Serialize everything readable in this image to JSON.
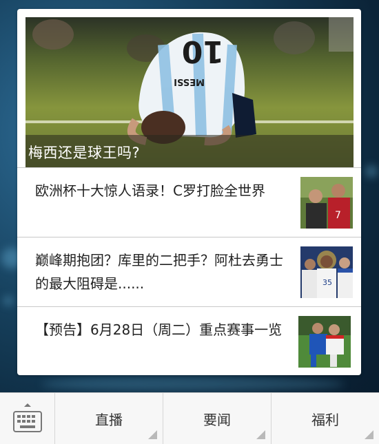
{
  "hero": {
    "caption": "梅西还是球王吗?",
    "jersey_name": "MESSI",
    "jersey_number": "10"
  },
  "news": [
    {
      "title": "欧洲杯十大惊人语录！C罗打脸全世界",
      "thumb_icon": "soccer-players-photo"
    },
    {
      "title": "巅峰期抱团？库里的二把手？阿杜去勇士的最大阻碍是......",
      "thumb_icon": "basketball-players-photo"
    },
    {
      "title": "【预告】6月28日（周二）重点赛事一览",
      "thumb_icon": "soccer-match-photo"
    }
  ],
  "bottom_bar": {
    "keyboard_icon": "keyboard-icon",
    "tabs": [
      {
        "label": "直播"
      },
      {
        "label": "要闻"
      },
      {
        "label": "福利"
      }
    ]
  },
  "colors": {
    "background": "#17425f",
    "card": "#ffffff",
    "divider": "#c8c8c8",
    "bottom_bar": "#f7f7f7"
  }
}
